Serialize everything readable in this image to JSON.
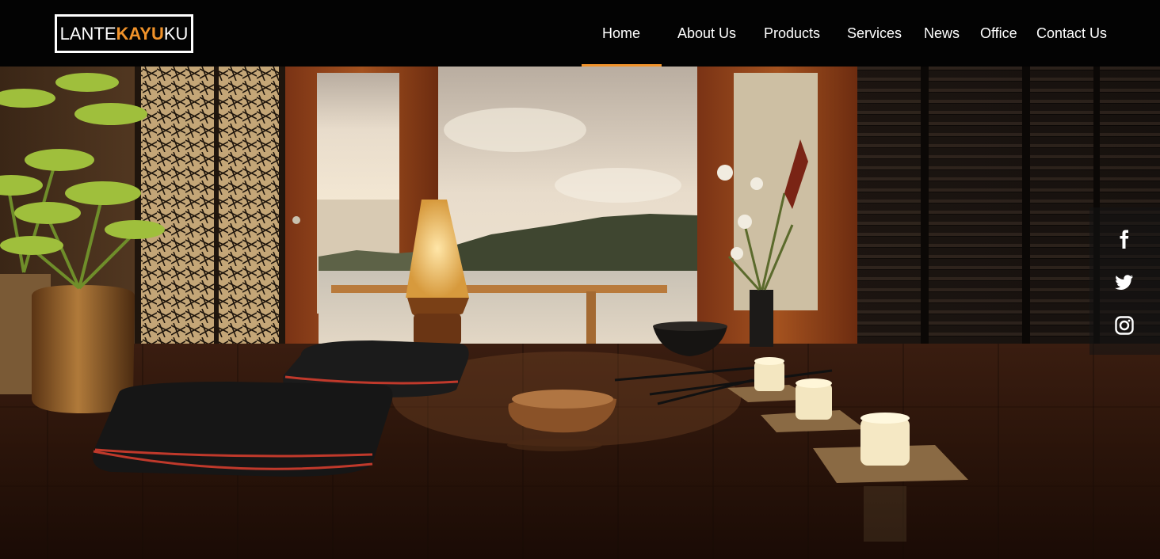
{
  "brand": {
    "part1": "LANTE",
    "part2": "KAYU",
    "part3": "KU",
    "accent_color": "#f0922a"
  },
  "nav": {
    "items": [
      {
        "label": "Home",
        "active": true
      },
      {
        "label": "About Us"
      },
      {
        "label": "Products"
      },
      {
        "label": "Services"
      },
      {
        "label": "News"
      },
      {
        "label": "Office"
      },
      {
        "label": "Contact Us"
      }
    ]
  },
  "hero": {
    "image": "zen-living-room-photo"
  },
  "social": {
    "icons": [
      "facebook-icon",
      "twitter-icon",
      "instagram-icon"
    ]
  },
  "colors": {
    "navbar_bg": "#030303",
    "text": "#ffffff"
  }
}
